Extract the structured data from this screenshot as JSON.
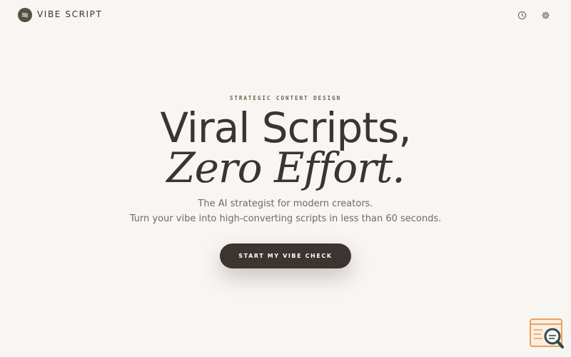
{
  "header": {
    "brand": "VIBE SCRIPT",
    "logo_icon": "waves-icon",
    "history_icon": "clock-icon",
    "settings_icon": "gear-icon"
  },
  "hero": {
    "eyebrow": "STRATEGIC CONTENT DESIGN",
    "title_line1": "Viral Scripts,",
    "title_line2": "Zero Effort.",
    "subtitle_line1": "The AI strategist for modern creators.",
    "subtitle_line2": "Turn your vibe into high-converting scripts in less than 60 seconds.",
    "cta_label": "START MY VIBE CHECK"
  },
  "widget": {
    "icon": "search-document-icon"
  },
  "colors": {
    "background": "#f8f6f2",
    "text": "#3a3531",
    "logo": "#55513f",
    "cta": "#3b3430",
    "widget_accent": "#e8a25a",
    "widget_dark": "#2f4a4c"
  }
}
